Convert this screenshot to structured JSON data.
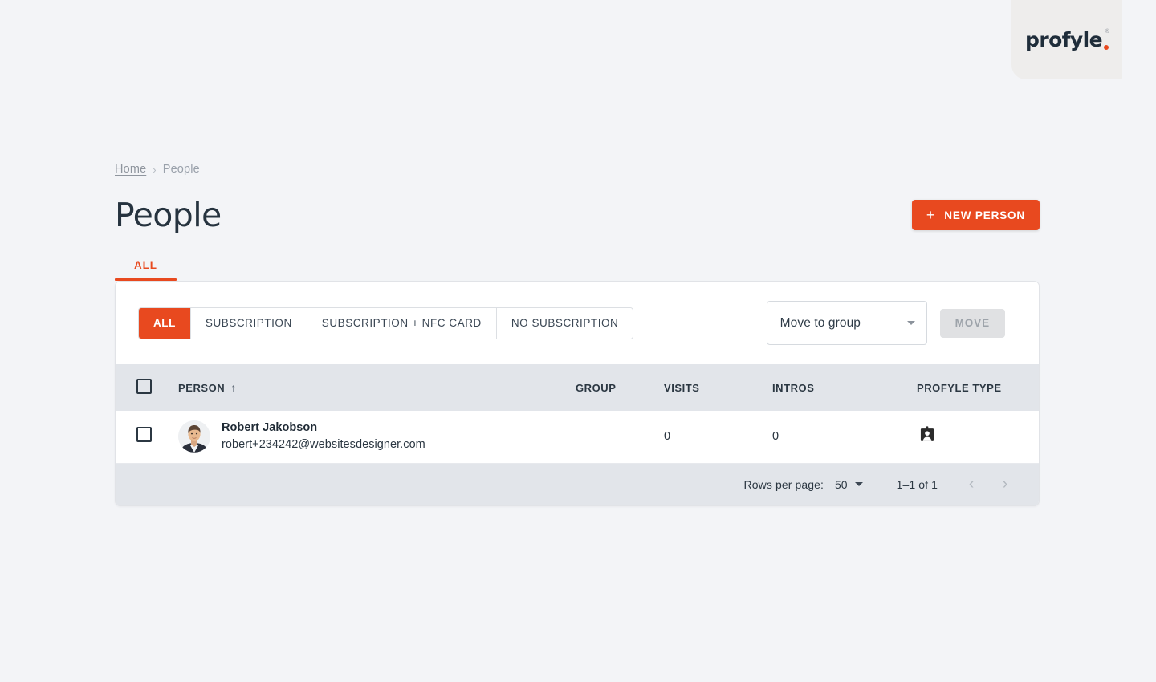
{
  "brand": {
    "logo_text": "profyle",
    "registered_mark": "®",
    "accent_color": "#e8491f",
    "logo_dot": "accent-dot"
  },
  "breadcrumb": {
    "home_label": "Home",
    "separator": "›",
    "current_label": "People"
  },
  "header": {
    "page_title": "People",
    "new_person_label": "NEW PERSON",
    "new_person_plus": "+"
  },
  "tabs": [
    {
      "label": "ALL",
      "active": true
    }
  ],
  "toolbar": {
    "filters": [
      {
        "label": "ALL",
        "active": true
      },
      {
        "label": "SUBSCRIPTION",
        "active": false
      },
      {
        "label": "SUBSCRIPTION + NFC CARD",
        "active": false
      },
      {
        "label": "NO SUBSCRIPTION",
        "active": false
      }
    ],
    "group_select": {
      "value": "Move to group",
      "placeholder": "Move to group"
    },
    "move_button_label": "MOVE",
    "move_button_disabled": true
  },
  "table": {
    "columns": [
      {
        "key": "checkbox",
        "label": ""
      },
      {
        "key": "person",
        "label": "PERSON",
        "sorted": true,
        "sort_arrow": "↑"
      },
      {
        "key": "group",
        "label": "GROUP"
      },
      {
        "key": "visits",
        "label": "VISITS"
      },
      {
        "key": "intros",
        "label": "INTROS"
      },
      {
        "key": "profyle_type",
        "label": "PROFYLE TYPE"
      }
    ],
    "rows": [
      {
        "selected": false,
        "name": "Robert Jakobson",
        "email": "robert+234242@websitesdesigner.com",
        "avatar": "person-photo",
        "group": "",
        "visits": "0",
        "intros": "0",
        "profyle_type_icon": "id-badge-icon"
      }
    ]
  },
  "pagination": {
    "rows_per_page_label": "Rows per page:",
    "rows_per_page_value": "50",
    "range_label": "1–1 of 1",
    "prev_label": "‹",
    "next_label": "›"
  }
}
